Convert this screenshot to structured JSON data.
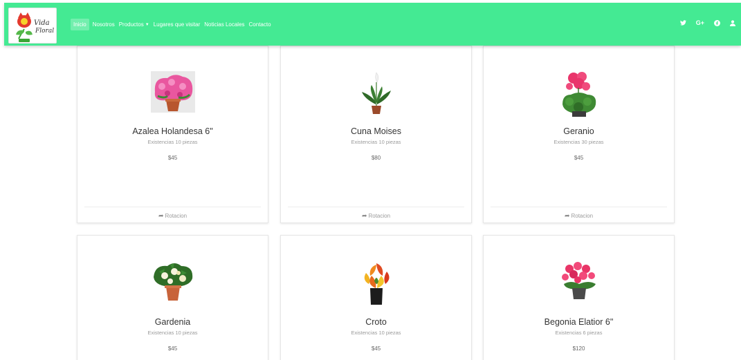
{
  "brand": {
    "logo_name": "Vida Floral",
    "logo_line1": "Vida",
    "logo_line2": "Floral"
  },
  "nav": {
    "items": [
      {
        "label": "Inicio"
      },
      {
        "label": "Nosotros"
      },
      {
        "label": "Productos"
      },
      {
        "label": "Lugares que visitar"
      },
      {
        "label": "Noticias Locales"
      },
      {
        "label": "Contacto"
      }
    ],
    "social_icons": [
      "twitter-icon",
      "google-plus-icon",
      "facebook-icon",
      "user-icon"
    ],
    "google_label": "G+"
  },
  "colors": {
    "navbar": "#44ea93",
    "nav_text": "#ffffff"
  },
  "products": [
    {
      "name": "Azalea Holandesa 6\"",
      "stock": "Existencias 10 piezas",
      "price": "$45",
      "action": "Rotacion"
    },
    {
      "name": "Cuna Moises",
      "stock": "Existencias 10 piezas",
      "price": "$80",
      "action": "Rotacion"
    },
    {
      "name": "Geranio",
      "stock": "Existencias 30 piezas",
      "price": "$45",
      "action": "Rotacion"
    },
    {
      "name": "Gardenia",
      "stock": "Existencias 10 piezas",
      "price": "$45"
    },
    {
      "name": "Croto",
      "stock": "Existencias 10 piezas",
      "price": "$45"
    },
    {
      "name": "Begonia Elatior 6\"",
      "stock": "Existencias 6 piezas",
      "price": "$120"
    }
  ]
}
